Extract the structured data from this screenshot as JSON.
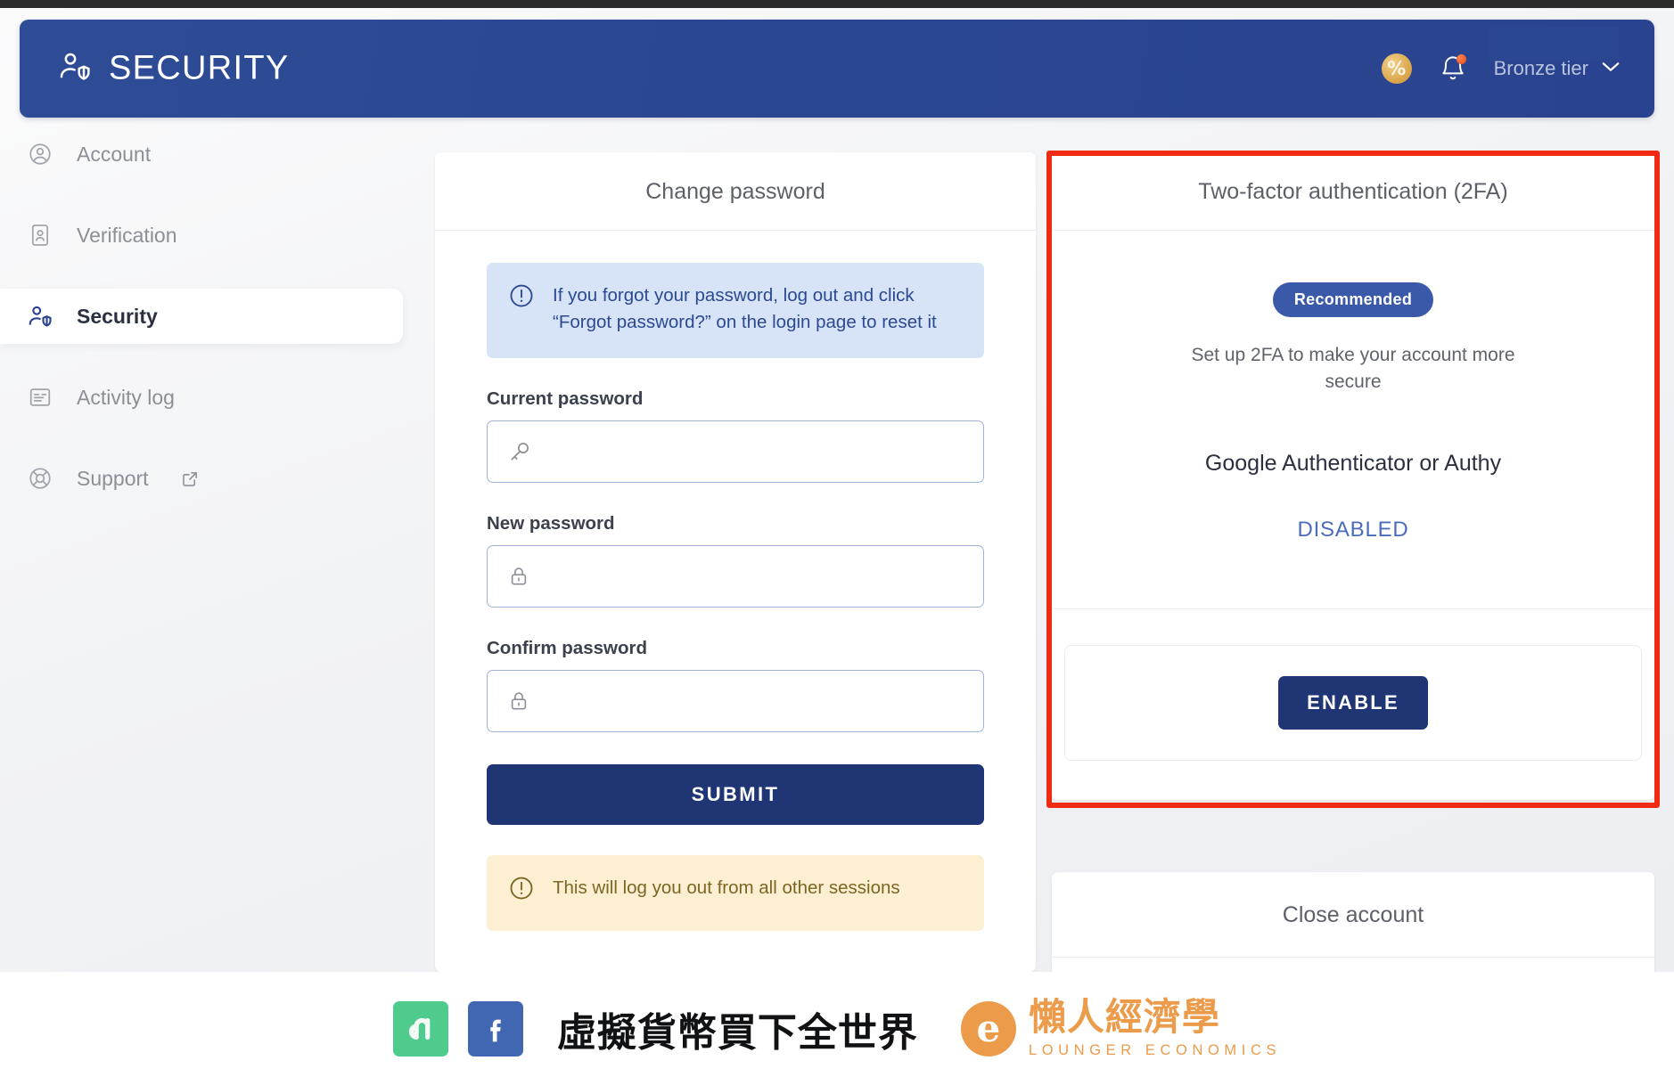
{
  "header": {
    "title": "SECURITY",
    "brand_icon": "user-shield-icon",
    "coin_icon_label": "%",
    "coin_icon": "percent-coin-icon",
    "bell_icon": "notification-bell-icon",
    "tier_label": "Bronze tier",
    "chevron_icon": "chevron-down-icon",
    "accent_color": "#2a4390"
  },
  "sidebar": {
    "items": [
      {
        "label": "Account",
        "icon": "user-circle-icon",
        "active": false,
        "external": false
      },
      {
        "label": "Verification",
        "icon": "id-card-icon",
        "active": false,
        "external": false
      },
      {
        "label": "Security",
        "icon": "user-shield-icon",
        "active": true,
        "external": false
      },
      {
        "label": "Activity log",
        "icon": "list-document-icon",
        "active": false,
        "external": false
      },
      {
        "label": "Support",
        "icon": "lifebuoy-icon",
        "active": false,
        "external": true
      }
    ]
  },
  "change_password": {
    "title": "Change password",
    "info_alert": {
      "icon": "exclamation-circle-icon",
      "text": "If you forgot your password, log out and click “Forgot password?” on the login page to reset it"
    },
    "fields": [
      {
        "label": "Current password",
        "icon": "key-icon",
        "value": "",
        "placeholder": ""
      },
      {
        "label": "New password",
        "icon": "lock-icon",
        "value": "",
        "placeholder": ""
      },
      {
        "label": "Confirm password",
        "icon": "lock-icon",
        "value": "",
        "placeholder": ""
      }
    ],
    "submit_label": "SUBMIT",
    "warn_alert": {
      "icon": "exclamation-circle-icon",
      "text": "This will log you out from all other sessions"
    }
  },
  "two_factor": {
    "title": "Two-factor authentication (2FA)",
    "badge": "Recommended",
    "description": "Set up 2FA to make your account more secure",
    "method": "Google Authenticator or Authy",
    "status": "DISABLED",
    "enable_label": "ENABLE",
    "highlight_color": "#f02b13",
    "status_color": "#4a6cbb"
  },
  "close_account": {
    "title": "Close account"
  },
  "footer": {
    "line_logo": "line-icon",
    "facebook_logo": "facebook-icon",
    "tagline": "虛擬貨幣買下全世界",
    "brand_mark": "le-monogram-icon",
    "brand_cn": "懶人經濟學",
    "brand_en": "LOUNGER ECONOMICS",
    "brand_color": "#eb9b4a"
  }
}
